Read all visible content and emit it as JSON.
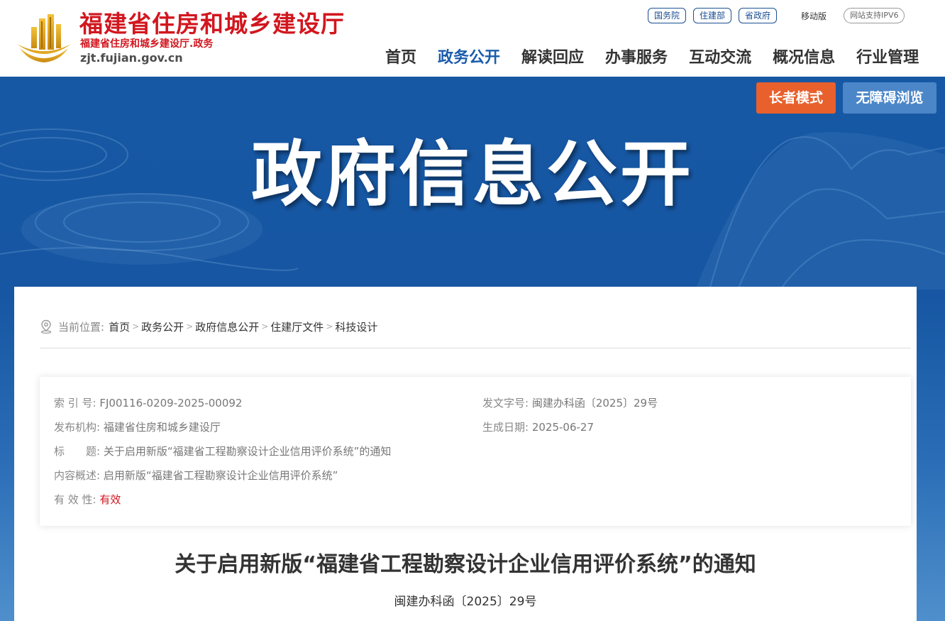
{
  "header": {
    "logo_title": "福建省住房和城乡建设厅",
    "logo_subtitle": "福建省住房和城乡建设厅.政务",
    "logo_domain": "zjt.fujian.gov.cn",
    "top_links": [
      "国务院",
      "住建部",
      "省政府"
    ],
    "mobile_label": "移动版",
    "ipv6_label": "网站支持IPV6",
    "nav": [
      "首页",
      "政务公开",
      "解读回应",
      "办事服务",
      "互动交流",
      "概况信息",
      "行业管理"
    ],
    "active_nav": "政务公开"
  },
  "banner": {
    "title": "政府信息公开",
    "elder_mode": "长者模式",
    "accessibility": "无障碍浏览"
  },
  "breadcrumb": {
    "label": "当前位置:",
    "items": [
      "首页",
      "政务公开",
      "政府信息公开",
      "住建厅文件",
      "科技设计"
    ],
    "separator": ">"
  },
  "meta": {
    "index_label": "索 引 号:",
    "index_value": "FJ00116-0209-2025-00092",
    "docno_label": "发文字号:",
    "docno_value": "闽建办科函〔2025〕29号",
    "publisher_label": "发布机构:",
    "publisher_value": "福建省住房和城乡建设厅",
    "date_label": "生成日期:",
    "date_value": "2025-06-27",
    "title_label": "标　　题:",
    "title_value": "关于启用新版“福建省工程勘察设计企业信用评价系统”的通知",
    "summary_label": "内容概述:",
    "summary_value": "启用新版“福建省工程勘察设计企业信用评价系统”",
    "validity_label": "有 效 性:",
    "validity_value": "有效"
  },
  "document": {
    "title": "关于启用新版“福建省工程勘察设计企业信用评价系统”的通知",
    "number": "闽建办科函〔2025〕29号"
  },
  "colors": {
    "brand_red": "#d2161e",
    "nav_active": "#1b5cab",
    "banner_blue": "#1758a4",
    "elder_orange": "#e8602c",
    "access_blue": "#4b86c8"
  }
}
